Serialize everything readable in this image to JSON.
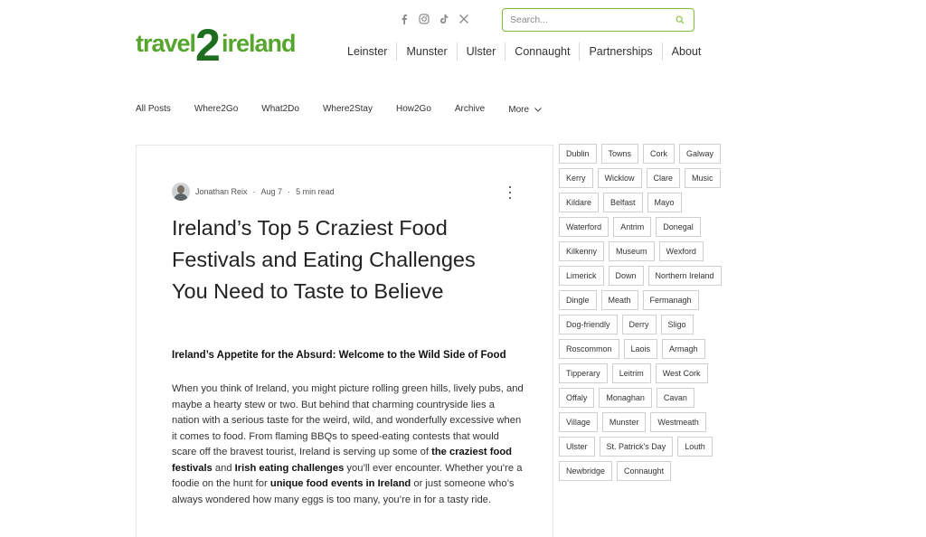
{
  "brand": {
    "logo_text_left": "travel",
    "logo_text_num": "2",
    "logo_text_right": "ireland",
    "colors": {
      "green": "#56a52c",
      "dark_green": "#1f6e1f",
      "accent": "#7bbf3a"
    }
  },
  "socials": [
    {
      "icon": "facebook-icon"
    },
    {
      "icon": "instagram-icon"
    },
    {
      "icon": "tiktok-icon"
    },
    {
      "icon": "x-icon"
    }
  ],
  "search": {
    "placeholder": "Search..."
  },
  "main_nav": [
    "Leinster",
    "Munster",
    "Ulster",
    "Connaught",
    "Partnerships",
    "About"
  ],
  "category_nav": {
    "items": [
      "All Posts",
      "Where2Go",
      "What2Do",
      "Where2Stay",
      "How2Go",
      "Archive"
    ],
    "more_label": "More"
  },
  "post": {
    "author": "Jonathan Reix",
    "date": "Aug 7",
    "read_time": "5 min read",
    "separator": "·",
    "title": "Ireland’s Top 5 Craziest Food Festivals and Eating Challenges You Need to Taste to Believe",
    "subtitle": "Ireland’s Appetite for the Absurd: Welcome to the Wild Side of Food",
    "p1": "When you think of Ireland, you might picture rolling green hills, lively pubs, and maybe a hearty stew or two. But behind that charming countryside lies a nation with a serious taste for the weird, wild, and wonderfully excessive when it comes to food. From flaming BBQs to speed-eating contests that would scare off the bravest tourist, Ireland is serving up some of ",
    "p1_bold1": "the craziest food festivals",
    "p1_and": " and ",
    "p1_bold2": "Irish eating challenges",
    "p1_mid": " you’ll ever encounter. Whether you’re a foodie on the hunt for ",
    "p1_bold3": "unique food events in Ireland",
    "p1_end": " or just someone who’s always wondered how many eggs is too many, you’re in for a tasty ride."
  },
  "tags": [
    "Dublin",
    "Towns",
    "Cork",
    "Galway",
    "Kerry",
    "Wicklow",
    "Clare",
    "Music",
    "Kildare",
    "Belfast",
    "Mayo",
    "Waterford",
    "Antrim",
    "Donegal",
    "Kilkenny",
    "Museum",
    "Wexford",
    "Limerick",
    "Down",
    "Northern Ireland",
    "Dingle",
    "Meath",
    "Fermanagh",
    "Dog-friendly",
    "Derry",
    "Sligo",
    "Roscommon",
    "Laois",
    "Armagh",
    "Tipperary",
    "Leitrim",
    "West Cork",
    "Offaly",
    "Monaghan",
    "Cavan",
    "Village",
    "Munster",
    "Westmeath",
    "Ulster",
    "St. Patrick's Day",
    "Louth",
    "Newbridge",
    "Connaught"
  ]
}
